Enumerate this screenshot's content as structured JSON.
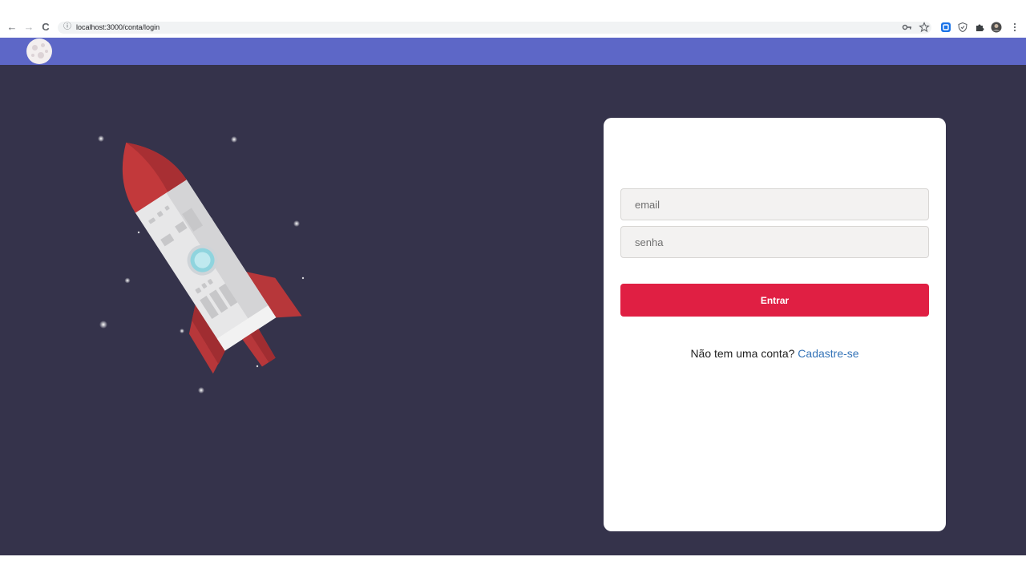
{
  "browser": {
    "url": "localhost:3000/conta/login",
    "back_icon": "←",
    "forward_icon": "→",
    "reload_icon": "C",
    "info_icon": "ⓘ"
  },
  "login": {
    "email_placeholder": "email",
    "password_placeholder": "senha",
    "submit_label": "Entrar",
    "signup_prompt": "Não tem uma conta?",
    "signup_link": "Cadastre-se"
  },
  "colors": {
    "header": "#5d67c7",
    "background": "#35334b",
    "button": "#e01f43",
    "link": "#3574b8"
  }
}
